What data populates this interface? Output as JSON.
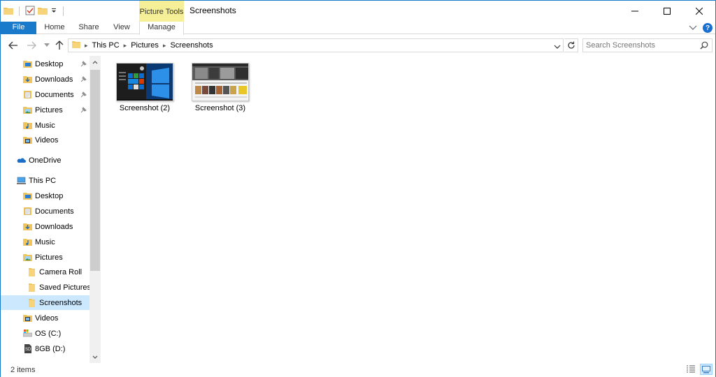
{
  "window": {
    "title": "Screenshots",
    "context_tab_group": "Picture Tools"
  },
  "ribbon": {
    "tabs": [
      {
        "label": "File"
      },
      {
        "label": "Home"
      },
      {
        "label": "Share"
      },
      {
        "label": "View"
      },
      {
        "label": "Manage"
      }
    ]
  },
  "address": {
    "crumbs": [
      "This PC",
      "Pictures",
      "Screenshots"
    ]
  },
  "search": {
    "placeholder": "Search Screenshots"
  },
  "nav": {
    "items": [
      {
        "label": "Desktop",
        "icon": "desktop-folder-icon",
        "pinned": true
      },
      {
        "label": "Downloads",
        "icon": "downloads-folder-icon",
        "pinned": true
      },
      {
        "label": "Documents",
        "icon": "documents-folder-icon",
        "pinned": true
      },
      {
        "label": "Pictures",
        "icon": "pictures-folder-icon",
        "pinned": true
      },
      {
        "label": "Music",
        "icon": "music-folder-icon",
        "pinned": false
      },
      {
        "label": "Videos",
        "icon": "videos-folder-icon",
        "pinned": false
      },
      {
        "label": "OneDrive",
        "icon": "onedrive-icon",
        "pinned": false
      },
      {
        "label": "This PC",
        "icon": "this-pc-icon",
        "pinned": false
      },
      {
        "label": "Desktop",
        "icon": "desktop-folder-icon",
        "pinned": false
      },
      {
        "label": "Documents",
        "icon": "documents-folder-icon",
        "pinned": false
      },
      {
        "label": "Downloads",
        "icon": "downloads-folder-icon",
        "pinned": false
      },
      {
        "label": "Music",
        "icon": "music-folder-icon",
        "pinned": false
      },
      {
        "label": "Pictures",
        "icon": "pictures-folder-icon",
        "pinned": false
      },
      {
        "label": "Camera Roll",
        "icon": "folder-icon",
        "pinned": false
      },
      {
        "label": "Saved Pictures",
        "icon": "folder-icon",
        "pinned": false
      },
      {
        "label": "Screenshots",
        "icon": "folder-icon",
        "pinned": false,
        "selected": true
      },
      {
        "label": "Videos",
        "icon": "videos-folder-icon",
        "pinned": false
      },
      {
        "label": "OS (C:)",
        "icon": "drive-c-icon",
        "pinned": false
      },
      {
        "label": "8GB (D:)",
        "icon": "sd-card-icon",
        "pinned": false
      }
    ]
  },
  "files": [
    {
      "name": "Screenshot (2)",
      "thumbnail": "windows-start-menu-thumbnail"
    },
    {
      "name": "Screenshot (3)",
      "thumbnail": "media-app-thumbnail"
    }
  ],
  "status": {
    "count": "2 items"
  },
  "colors": {
    "accent": "#1979ca",
    "context_tab": "#f5f098",
    "selection": "#cce8ff",
    "folder": "#f2c55c"
  }
}
